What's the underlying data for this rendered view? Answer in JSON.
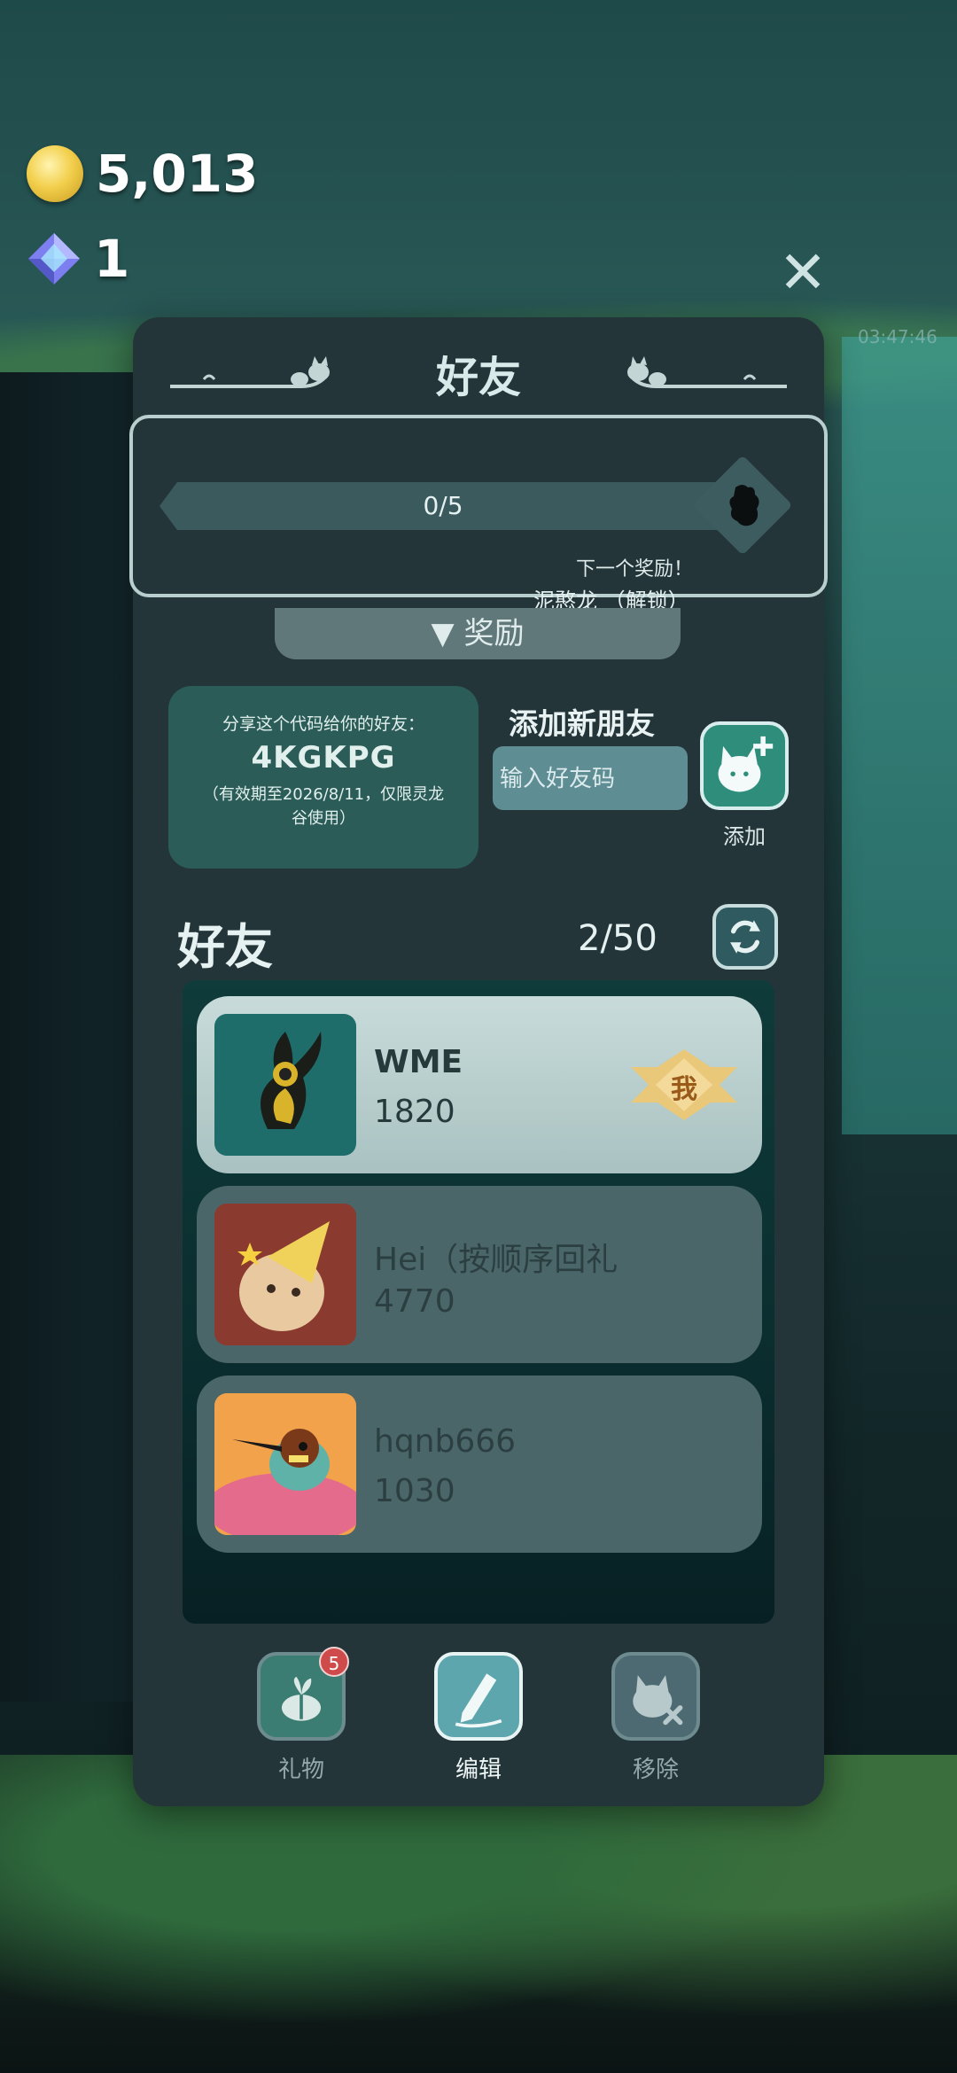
{
  "currency": {
    "coins": "5,013",
    "gems": "1"
  },
  "background": {
    "clock": "03:47:46"
  },
  "panel": {
    "title": "好友",
    "reward": {
      "progress_text": "0/5",
      "progress": 0,
      "next_reward": "下一个奖励！",
      "reward_name": "泥憨龙 （解锁）",
      "tab_label": "▼ 奖励"
    },
    "share": {
      "label": "分享这个代码给你的好友：",
      "code": "4KGKPG",
      "note": "（有效期至2026/8/11，仅限灵龙谷使用）"
    },
    "add_friend": {
      "title": "添加新朋友",
      "placeholder": "输入好友码",
      "button_label": "添加"
    },
    "friends": {
      "title": "好友",
      "count": "2/50",
      "list": [
        {
          "name": "WME",
          "score": "1820",
          "is_me": true,
          "badge": "我"
        },
        {
          "name": "Hei（按顺序回礼",
          "score": "4770",
          "is_me": false
        },
        {
          "name": "hqnb666",
          "score": "1030",
          "is_me": false
        }
      ]
    },
    "actions": {
      "gift_label": "礼物",
      "gift_badge": "5",
      "edit_label": "编辑",
      "remove_label": "移除"
    }
  },
  "colors": {
    "panel": "#24353a",
    "accent": "#2f8d7c",
    "badge_red": "#cf4b4b"
  }
}
